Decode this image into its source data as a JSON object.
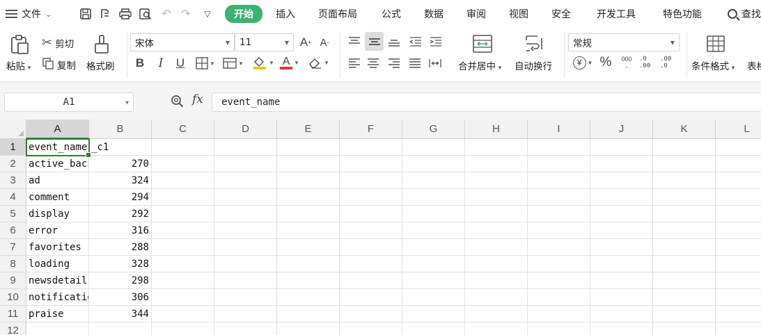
{
  "menu": {
    "file_label": "文件",
    "tabs": [
      "开始",
      "插入",
      "页面布局",
      "公式",
      "数据",
      "审阅",
      "视图",
      "安全",
      "开发工具",
      "特色功能"
    ],
    "active_tab": "开始",
    "search_label": "查找",
    "accent_color": "#3cb371"
  },
  "ribbon": {
    "paste_label": "粘贴",
    "cut_label": "剪切",
    "copy_label": "复制",
    "format_painter_label": "格式刷",
    "font_name": "宋体",
    "font_size": "11",
    "merge_center_label": "合并居中",
    "wrap_text_label": "自动换行",
    "number_format": "常规",
    "conditional_format_label": "条件格式",
    "table_style_label": "表格",
    "bold_label": "B",
    "italic_label": "I",
    "underline_label": "U",
    "percent_label": "%",
    "thousands_label": "000",
    "inc_decimal_label": ".0 .00",
    "dec_decimal_label": ".00 .0"
  },
  "formula_bar": {
    "name_box": "A1",
    "fx_label": "fx",
    "formula": "event_name"
  },
  "grid": {
    "columns": [
      "A",
      "B",
      "C",
      "D",
      "E",
      "F",
      "G",
      "H",
      "I",
      "J",
      "K",
      "L"
    ],
    "row_numbers": [
      "1",
      "2",
      "3",
      "4",
      "5",
      "6",
      "7",
      "8",
      "9",
      "10",
      "11",
      "12"
    ],
    "selected_column": "A",
    "selected_row": "1",
    "rows": [
      {
        "a": "event_name",
        "b": "_c1"
      },
      {
        "a": "active_background",
        "b": "270"
      },
      {
        "a": "ad",
        "b": "324"
      },
      {
        "a": "comment",
        "b": "294"
      },
      {
        "a": "display",
        "b": "292"
      },
      {
        "a": "error",
        "b": "316"
      },
      {
        "a": "favorites",
        "b": "288"
      },
      {
        "a": "loading",
        "b": "328"
      },
      {
        "a": "newsdetail",
        "b": "298"
      },
      {
        "a": "notification",
        "b": "306"
      },
      {
        "a": "praise",
        "b": "344"
      },
      {
        "a": "",
        "b": ""
      }
    ]
  }
}
